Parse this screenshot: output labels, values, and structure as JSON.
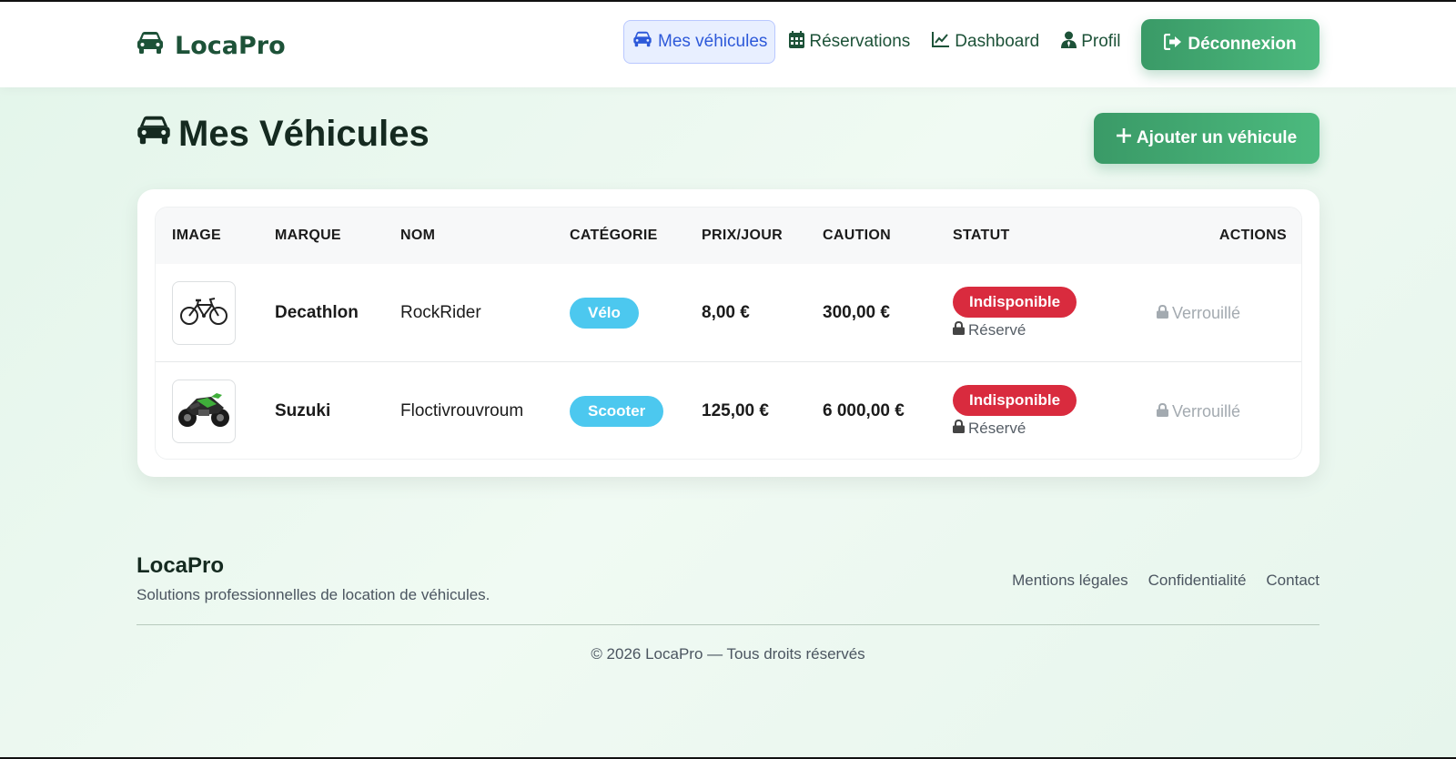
{
  "brand": {
    "name": "LocaPro",
    "icon": "car-icon"
  },
  "nav": {
    "items": [
      {
        "label": "Mes véhicules",
        "icon": "car-icon",
        "active": true
      },
      {
        "label": "Réservations",
        "icon": "calendar-icon",
        "active": false
      },
      {
        "label": "Dashboard",
        "icon": "chart-line-icon",
        "active": false
      },
      {
        "label": "Profil",
        "icon": "user-icon",
        "active": false
      }
    ],
    "logout_label": "Déconnexion"
  },
  "page": {
    "title": "Mes Véhicules",
    "add_button": "Ajouter un véhicule"
  },
  "table": {
    "headers": [
      "IMAGE",
      "MARQUE",
      "NOM",
      "CATÉGORIE",
      "PRIX/JOUR",
      "CAUTION",
      "STATUT",
      "ACTIONS"
    ],
    "rows": [
      {
        "image": "bicycle-image",
        "brand": "Decathlon",
        "name": "RockRider",
        "category": "Vélo",
        "price": "8,00 €",
        "deposit": "300,00 €",
        "status": "Indisponible",
        "status_note": "Réservé",
        "action": "Verrouillé"
      },
      {
        "image": "motorcycle-image",
        "brand": "Suzuki",
        "name": "Floctivrouvroum",
        "category": "Scooter",
        "price": "125,00 €",
        "deposit": "6 000,00 €",
        "status": "Indisponible",
        "status_note": "Réservé",
        "action": "Verrouillé"
      }
    ]
  },
  "footer": {
    "brand": "LocaPro",
    "tagline": "Solutions professionnelles de location de véhicules.",
    "links": [
      "Mentions légales",
      "Confidentialité",
      "Contact"
    ],
    "copyright": "© 2026 LocaPro — Tous droits réservés"
  },
  "colors": {
    "accent_green": "#3a9a67",
    "brand_text": "#1d5238",
    "active_nav": "#2d59d9",
    "category_pill": "#4cc8ef",
    "status_red": "#d92b3e"
  }
}
